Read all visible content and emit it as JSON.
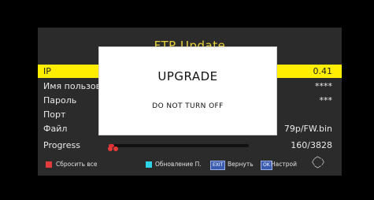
{
  "menu": {
    "title": "FTP Update",
    "rows": [
      {
        "label": "IP",
        "value": "0.41"
      },
      {
        "label": "Имя пользова",
        "value": "****"
      },
      {
        "label": "Пароль",
        "value": "***"
      },
      {
        "label": "Порт",
        "value": ""
      },
      {
        "label": "Файл",
        "value": "79p/FW.bin"
      },
      {
        "label": "Progress",
        "value": "160/3828"
      }
    ],
    "progress_fraction": 0.042
  },
  "footer": {
    "red_label": "Сбросить все",
    "cyan_label": "Обновление П.",
    "exit_key": "EXIT",
    "exit_label": "Вернуть",
    "ok_key": "OK",
    "ok_label": "Настрой"
  },
  "modal": {
    "title": "UPGRADE",
    "message": "DO NOT TURN OFF"
  },
  "colors": {
    "selection": "#ffee00",
    "title": "#e8d13c",
    "progress": "#e03030",
    "red_key": "#e13b3b",
    "cyan_key": "#2fd3e6",
    "panel": "#2b2b2b"
  }
}
